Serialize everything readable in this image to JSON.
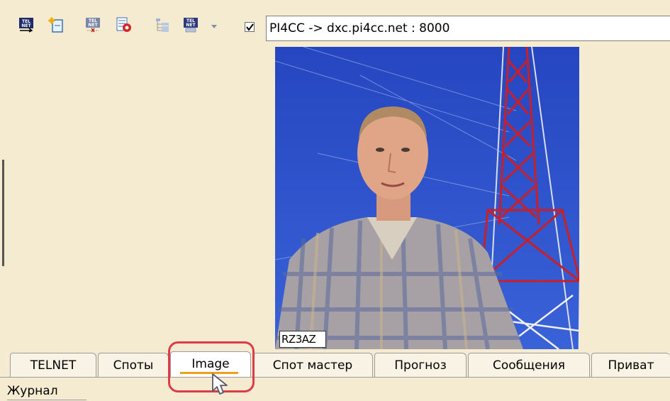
{
  "toolbar": {
    "buttons": [
      {
        "name": "telnet-connect-icon",
        "label": "TEL NET"
      },
      {
        "name": "new-window-icon",
        "label": ""
      },
      {
        "name": "telnet-disconnect-icon",
        "label": "TEL NET"
      },
      {
        "name": "telnet-settings-icon",
        "label": ""
      },
      {
        "name": "tree-icon",
        "label": ""
      },
      {
        "name": "telnet-list-icon",
        "label": "TEL NET"
      }
    ],
    "dropdown_arrow": "chevron-down-icon",
    "connection_checked": true,
    "connection_value": "PI4CC -> dxc.pi4cc.net : 8000"
  },
  "image_panel": {
    "caption": "RZ3AZ",
    "sky_color": "#2d4fc8",
    "tower_color": "#c8202a"
  },
  "tabs": {
    "items": [
      {
        "label": "TELNET",
        "active": false
      },
      {
        "label": "Споты",
        "active": false
      },
      {
        "label": "Image",
        "active": true
      },
      {
        "label": "Спот мастер",
        "active": false
      },
      {
        "label": "Прогноз",
        "active": false
      },
      {
        "label": "Сообщения",
        "active": false
      },
      {
        "label": "Приват",
        "active": false
      }
    ],
    "second_row": "Журнал",
    "highlight_color": "#dc3c48",
    "active_accent": "#f0a020"
  }
}
